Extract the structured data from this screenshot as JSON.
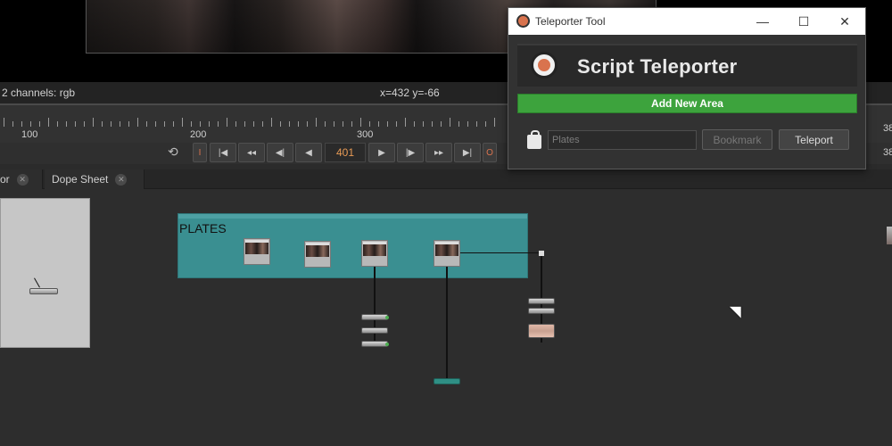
{
  "viewer": {
    "channels_text": "2 channels: rgb",
    "coords_text": "x=432 y=-66"
  },
  "timeline": {
    "tick_labels": [
      "100",
      "200",
      "300"
    ],
    "current_frame": "401",
    "right_label_a": "38",
    "right_label_b": "38"
  },
  "transport": {
    "in_label": "I",
    "out_label": "O"
  },
  "tabs": [
    {
      "label": "or"
    },
    {
      "label": "Dope Sheet"
    }
  ],
  "node_graph": {
    "backdrop_label": "PLATES"
  },
  "teleporter_window": {
    "title": "Teleporter Tool",
    "header": "Script Teleporter",
    "add_area_label": "Add New Area",
    "area_placeholder": "Plates",
    "bookmark_label": "Bookmark",
    "teleport_label": "Teleport",
    "minimize_glyph": "—",
    "maximize_glyph": "☐",
    "close_glyph": "✕"
  },
  "colors": {
    "accent_green": "#3da33d",
    "backdrop_teal": "#3a8f91",
    "frame_orange": "#e79a55"
  }
}
